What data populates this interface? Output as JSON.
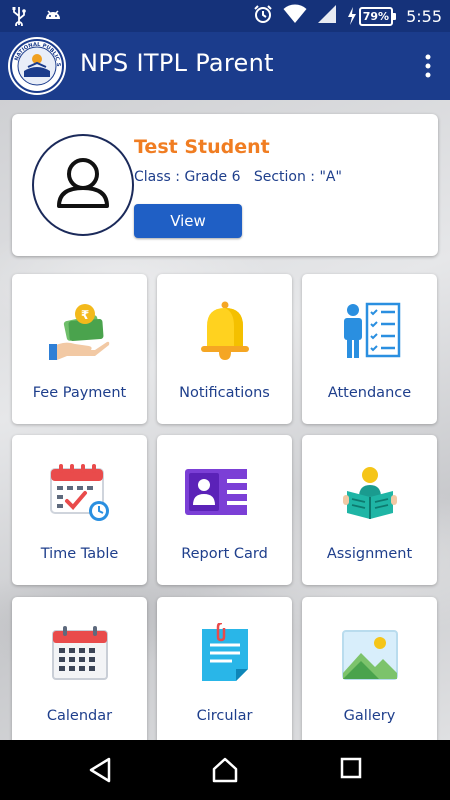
{
  "status_bar": {
    "time": "5:55",
    "battery": "79%",
    "icons": [
      "usb-icon",
      "android-icon",
      "alarm-icon",
      "wifi-icon",
      "signal-icon",
      "battery-icon"
    ]
  },
  "app_bar": {
    "title": "NPS ITPL Parent",
    "logo_text": "NATIONAL PUBLIC SCHOOL",
    "menu_icon": "overflow-menu-icon"
  },
  "student": {
    "name": "Test Student",
    "class_info": "Class : Grade 6   Section : \"A\"",
    "view_label": "View"
  },
  "tiles": [
    {
      "label": "Fee Payment",
      "icon": "fee-payment-icon"
    },
    {
      "label": "Notifications",
      "icon": "bell-icon"
    },
    {
      "label": "Attendance",
      "icon": "attendance-icon"
    },
    {
      "label": "Time Table",
      "icon": "timetable-icon"
    },
    {
      "label": "Report Card",
      "icon": "report-card-icon"
    },
    {
      "label": "Assignment",
      "icon": "assignment-icon"
    },
    {
      "label": "Calendar",
      "icon": "calendar-icon"
    },
    {
      "label": "Circular",
      "icon": "circular-icon"
    },
    {
      "label": "Gallery",
      "icon": "gallery-icon"
    }
  ],
  "nav_bar": [
    "back-icon",
    "home-icon",
    "recents-icon"
  ],
  "colors": {
    "app_bar": "#1b3c8c",
    "status_bar": "#15327a",
    "accent_orange": "#f07d22",
    "label_blue": "#1f3f8c",
    "button_blue": "#1f5fc5"
  }
}
